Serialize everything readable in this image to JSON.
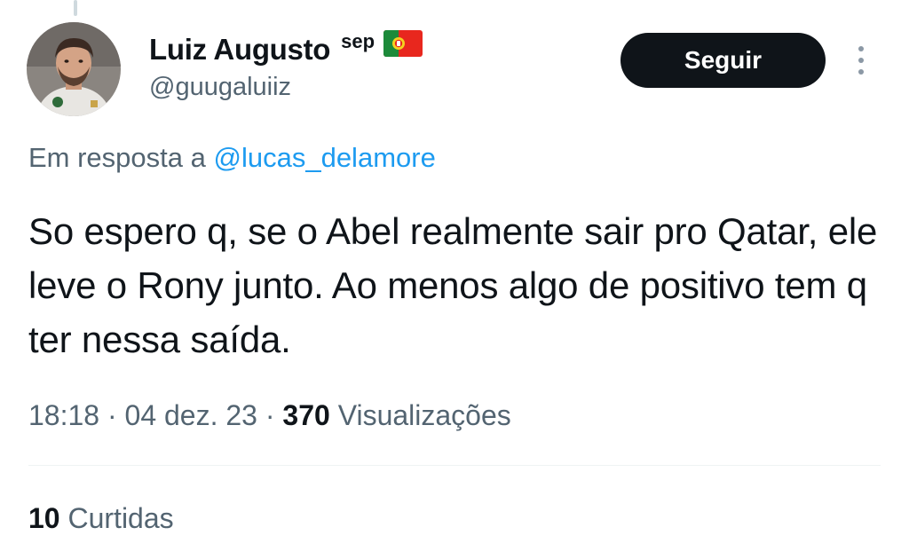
{
  "tweet": {
    "author": {
      "display_name": "Luiz Augusto",
      "name_suffix": "sep",
      "flag_icon": "portugal-flag-icon",
      "handle": "@guugaluiiz"
    },
    "follow_label": "Seguir",
    "more_icon": "more-vertical-icon",
    "reply_prefix": "Em resposta a",
    "reply_to": "@lucas_delamore",
    "text": "So espero q, se o Abel realmente sair pro Qatar, ele leve o Rony junto. Ao menos algo de positivo tem q ter nessa saída.",
    "time": "18:18",
    "separator": "·",
    "date": "04 dez. 23",
    "views_count": "370",
    "views_label": "Visualizações",
    "likes_count": "10",
    "likes_label": "Curtidas"
  },
  "colors": {
    "text_primary": "#0f1419",
    "text_secondary": "#536471",
    "link": "#1d9bf0",
    "button_bg": "#0f1419",
    "button_text": "#ffffff",
    "divider": "#eff3f4"
  }
}
